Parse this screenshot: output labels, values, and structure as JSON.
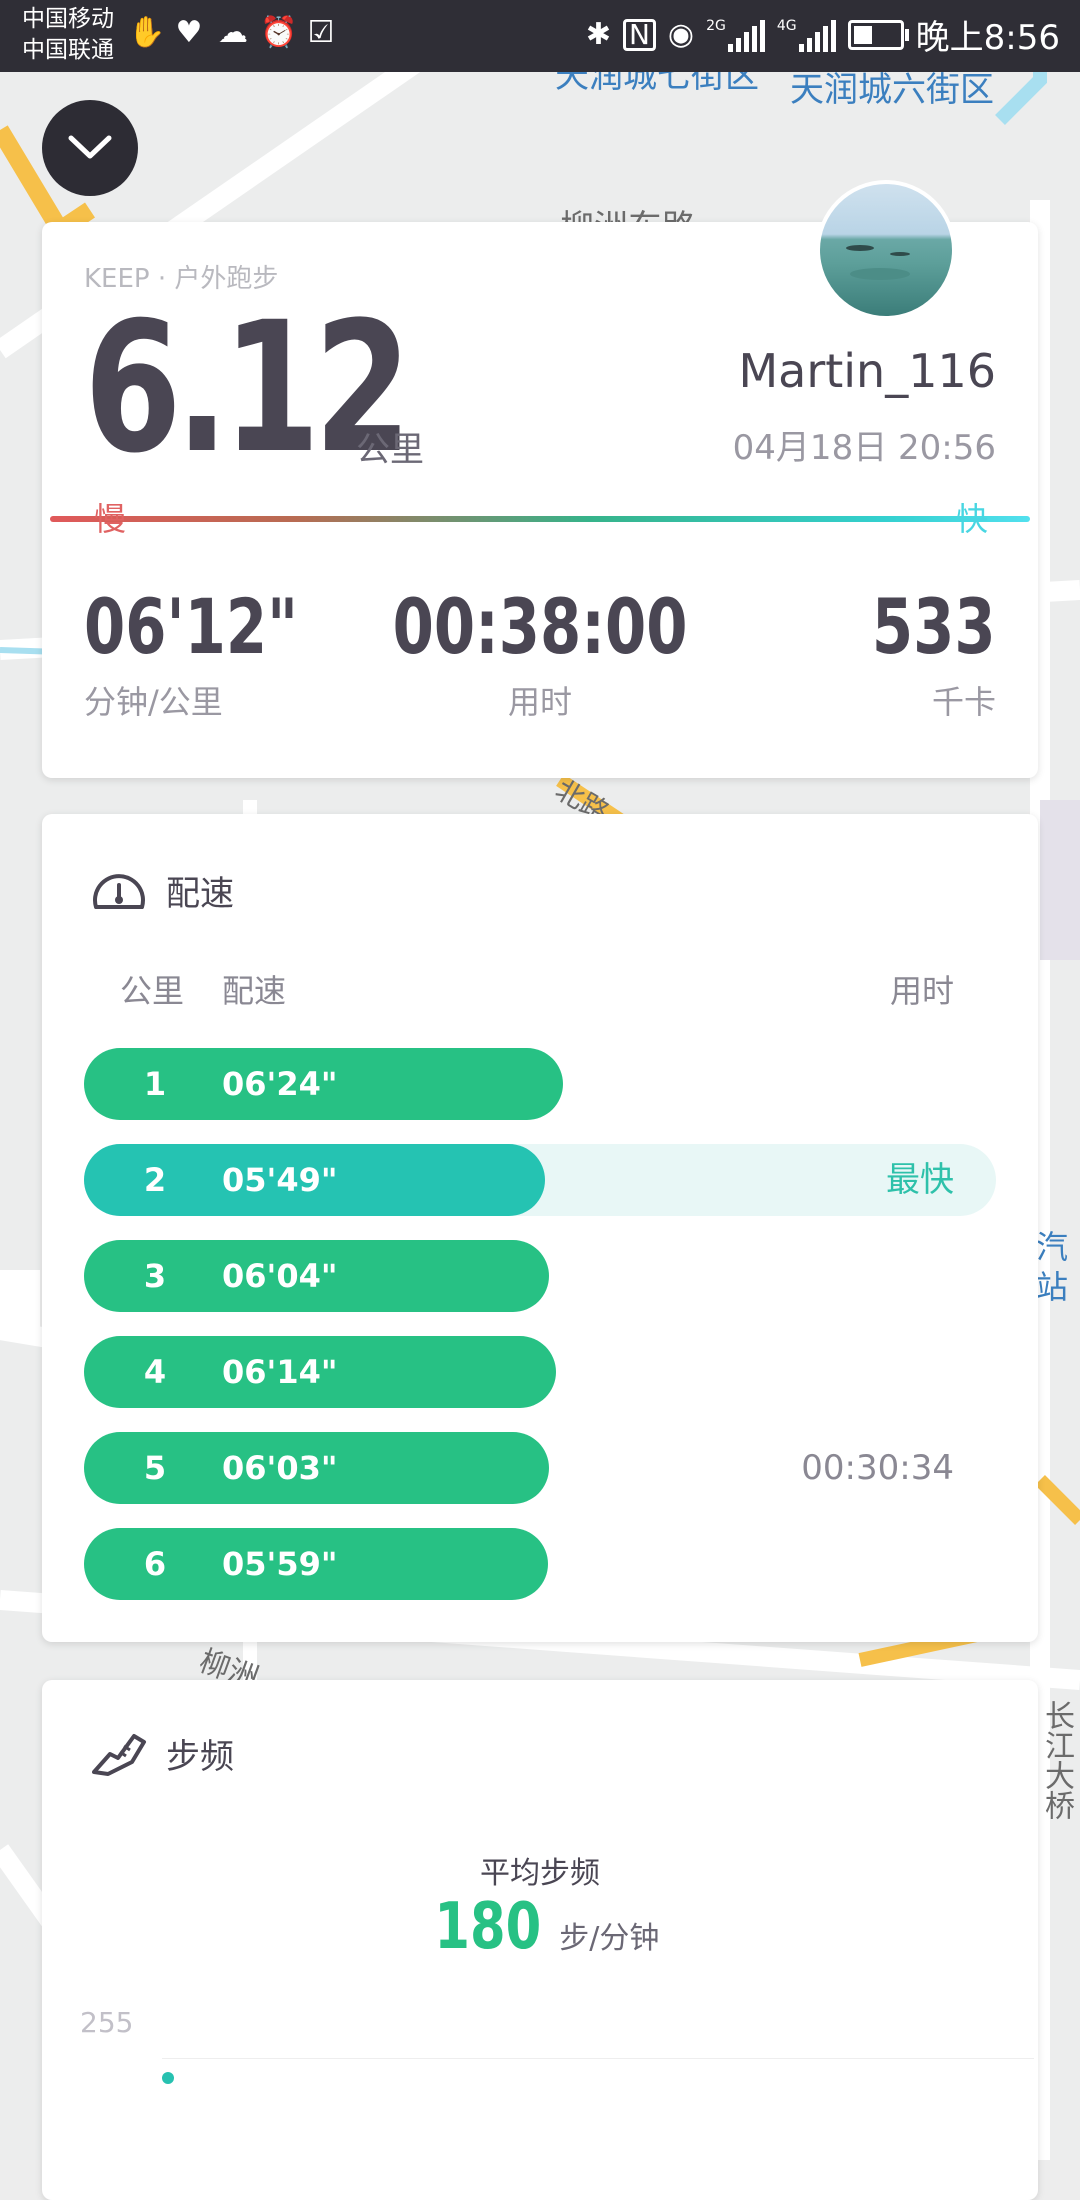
{
  "status_bar": {
    "carrier_1": "中国移动",
    "carrier_2": "中国联通",
    "network_1": "2G",
    "network_2": "4G",
    "time": "晚上8:56"
  },
  "map": {
    "labels": [
      "天润城七街区",
      "天润城六街区",
      "柳洲东路",
      "北路",
      "柳洲",
      "汽",
      "站",
      "长江大桥"
    ]
  },
  "summary": {
    "source": "KEEP · 户外跑步",
    "distance": "6.12",
    "distance_unit": "公里",
    "username": "Martin_116",
    "datetime": "04月18日 20:56",
    "slow_label": "慢",
    "fast_label": "快",
    "pace_value": "06'12\"",
    "pace_label": "分钟/公里",
    "time_value": "00:38:00",
    "time_label": "用时",
    "calories_value": "533",
    "calories_label": "千卡"
  },
  "pace_section": {
    "title": "配速",
    "col_km": "公里",
    "col_pace": "配速",
    "col_time": "用时",
    "fastest_tag": "最快",
    "rows": [
      {
        "km": "1",
        "pace": "06'24\"",
        "fill": 0.525
      },
      {
        "km": "2",
        "pace": "05'49\"",
        "fill": 0.505,
        "tag": "最快"
      },
      {
        "km": "3",
        "pace": "06'04\"",
        "fill": 0.51
      },
      {
        "km": "4",
        "pace": "06'14\"",
        "fill": 0.517
      },
      {
        "km": "5",
        "pace": "06'03\"",
        "fill": 0.51,
        "elapsed": "00:30:34"
      },
      {
        "km": "6",
        "pace": "05'59\"",
        "fill": 0.509
      }
    ]
  },
  "cadence_section": {
    "title": "步频",
    "avg_label": "平均步频",
    "avg_value": "180",
    "avg_unit": "步/分钟",
    "y_tick": "255"
  },
  "colors": {
    "bar_green": "#27c184",
    "bar_fastest": "#25c3b2",
    "text_dark": "#4a4653"
  }
}
